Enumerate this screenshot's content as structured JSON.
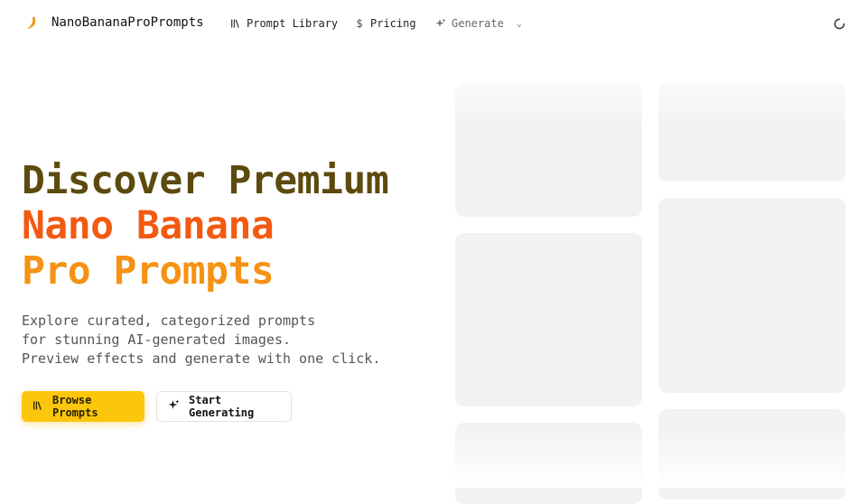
{
  "header": {
    "brand": "NanoBananaProPrompts",
    "nav": {
      "prompt_library": "Prompt Library",
      "pricing": "Pricing",
      "generate": "Generate"
    }
  },
  "hero": {
    "title_line1": "Discover Premium",
    "title_line2": "Nano Banana",
    "title_line3": "Pro Prompts",
    "subtitle_line1": "Explore curated, categorized prompts",
    "subtitle_line2": "for stunning AI-generated images.",
    "subtitle_line3": "Preview effects and generate with one click.",
    "primary_button": "Browse Prompts",
    "secondary_button": "Start Generating"
  },
  "colors": {
    "accent_yellow": "#fcc60d",
    "title_dark": "#5c4a0e",
    "title_orange": "#f25a12",
    "title_amber": "#f69214"
  },
  "icons": [
    "banana-logo-icon",
    "library-icon",
    "dollar-icon",
    "sparkles-icon",
    "chevron-down-icon",
    "loading-icon"
  ]
}
